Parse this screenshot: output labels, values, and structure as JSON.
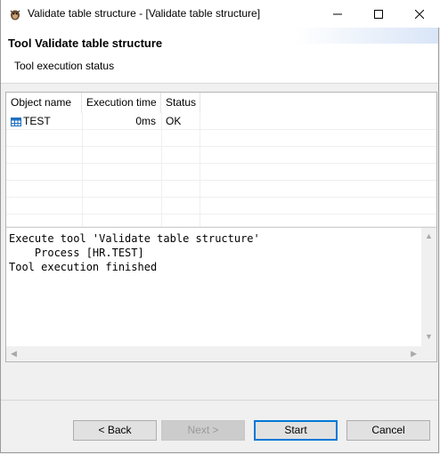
{
  "window": {
    "title": "Validate table structure - [Validate table structure]"
  },
  "header": {
    "title": "Tool Validate table structure",
    "subtitle": "Tool execution status"
  },
  "table": {
    "columns": [
      "Object name",
      "Execution time",
      "Status"
    ],
    "rows": [
      {
        "name": "TEST",
        "time": "0ms",
        "status": "OK",
        "icon": "table-icon"
      }
    ]
  },
  "log": {
    "text": "Execute tool 'Validate table structure'\n    Process [HR.TEST]\nTool execution finished"
  },
  "buttons": {
    "back": "< Back",
    "next": "Next >",
    "start": "Start",
    "cancel": "Cancel"
  },
  "icons": {
    "app": "dbeaver-beaver-icon",
    "minimize": "minimize-icon",
    "maximize": "maximize-icon",
    "close": "close-icon"
  },
  "colors": {
    "accent": "#0078d7",
    "header_gradient": "#d9e5f7"
  }
}
